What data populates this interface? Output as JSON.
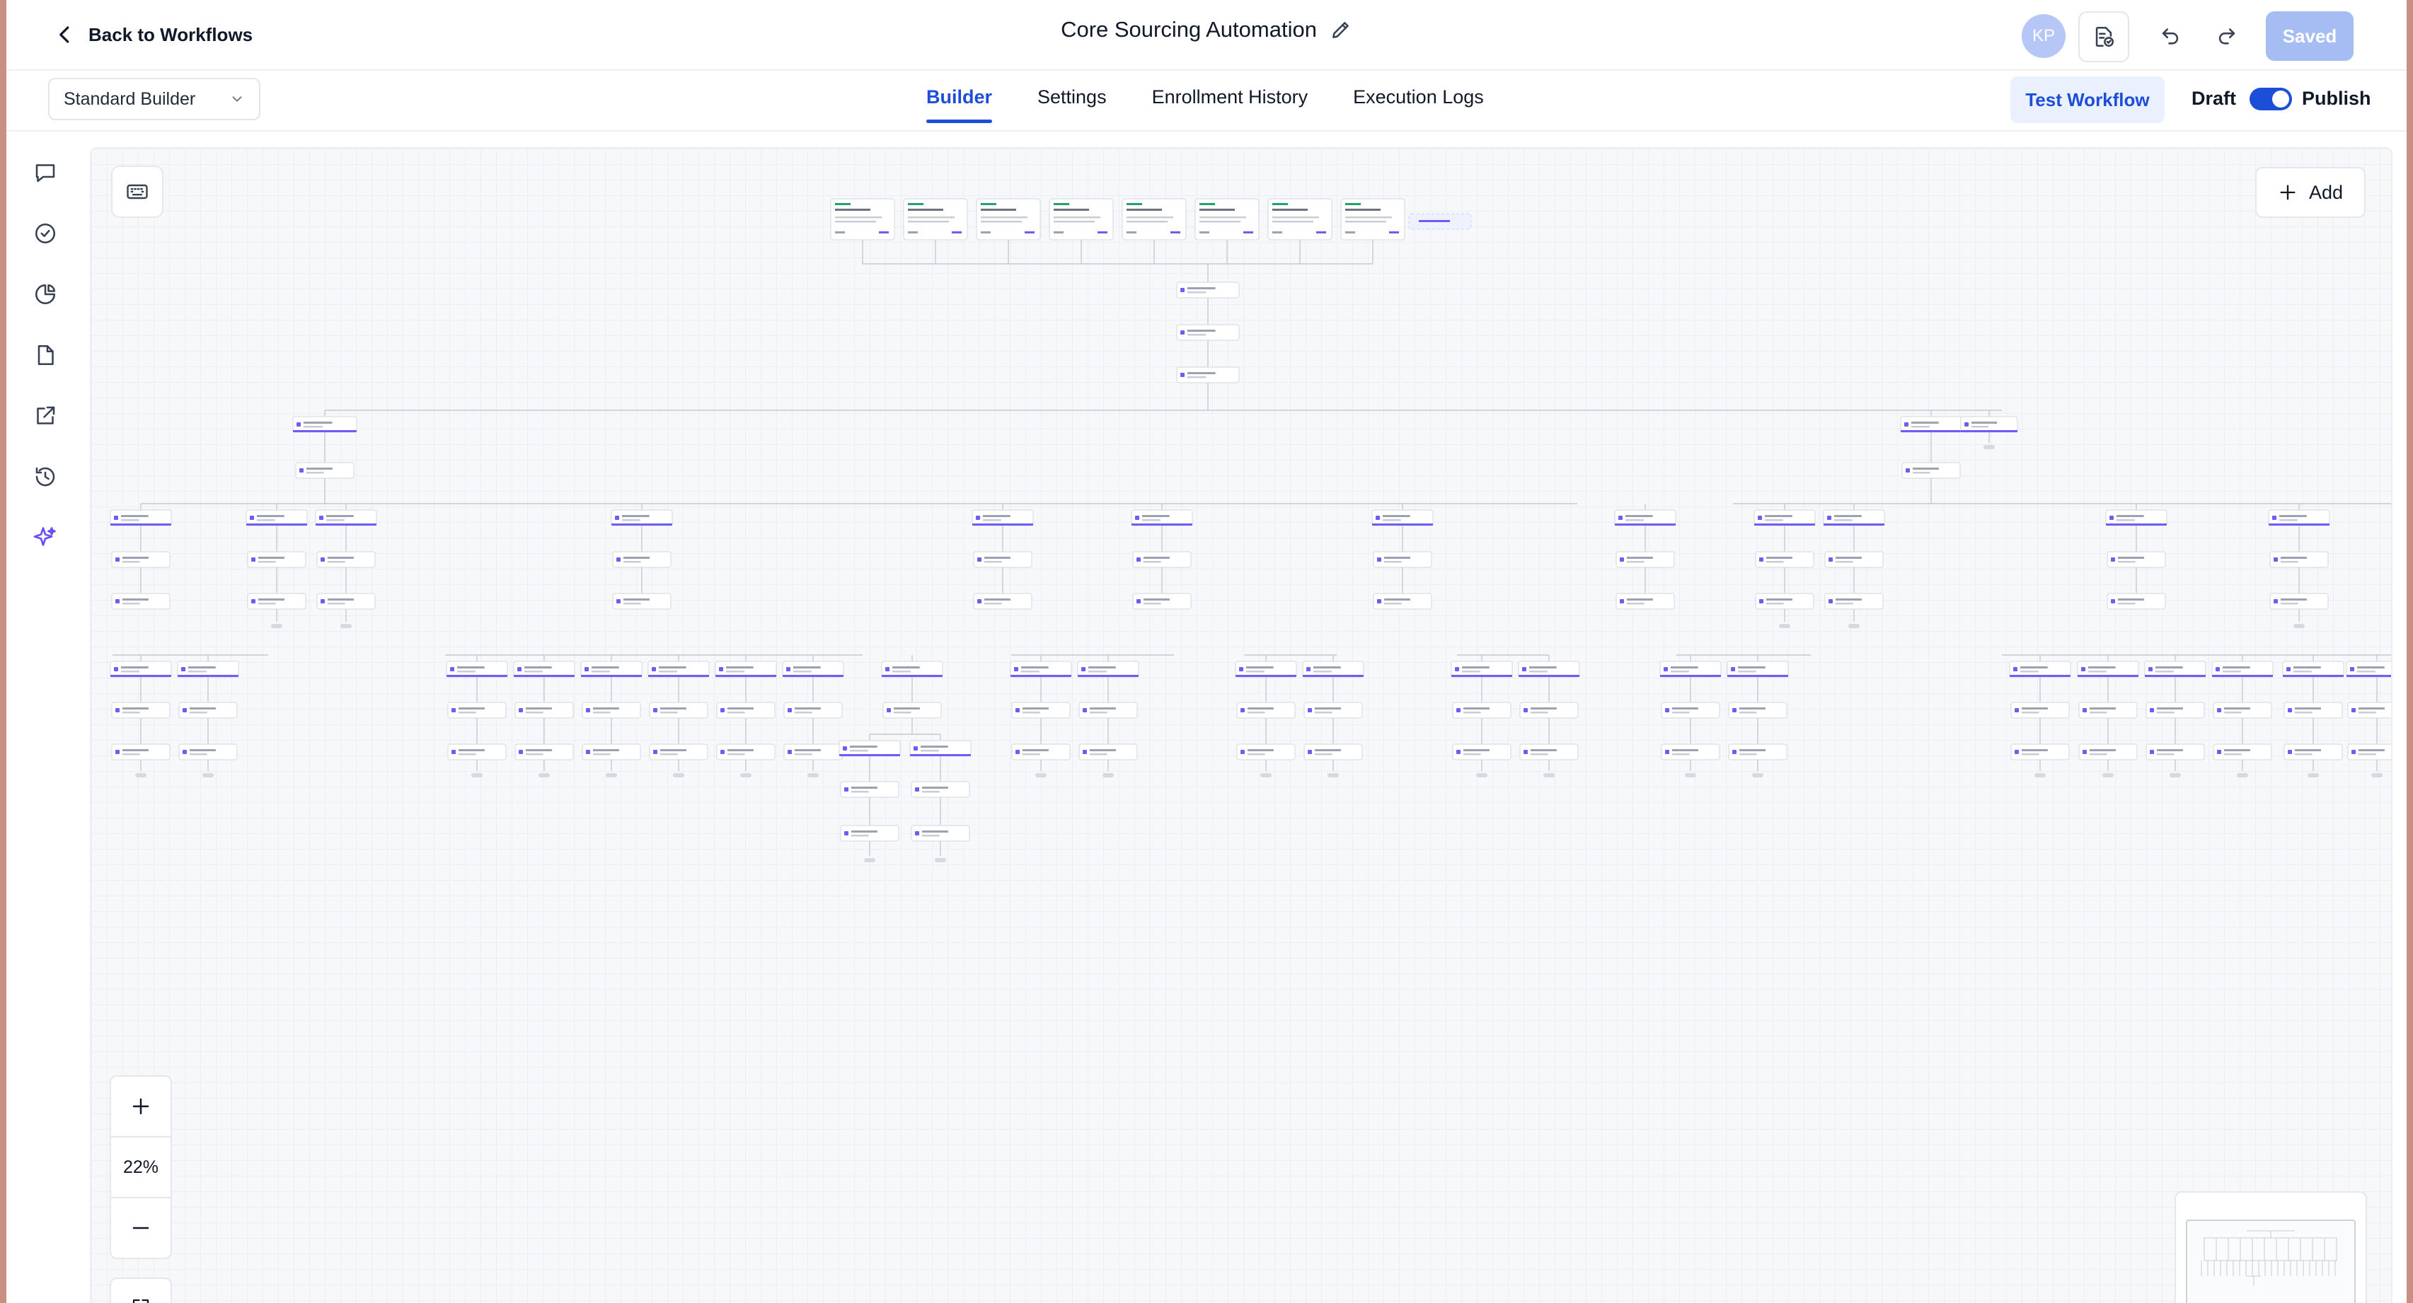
{
  "header": {
    "back_label": "Back to Workflows",
    "title": "Core Sourcing Automation",
    "avatar_initials": "KP",
    "saved_label": "Saved"
  },
  "toolbar": {
    "builder_mode": "Standard Builder",
    "tabs": [
      {
        "label": "Builder",
        "active": true
      },
      {
        "label": "Settings",
        "active": false
      },
      {
        "label": "Enrollment History",
        "active": false
      },
      {
        "label": "Execution Logs",
        "active": false
      }
    ],
    "test_label": "Test Workflow",
    "draft_label": "Draft",
    "publish_label": "Publish",
    "publish_enabled": true
  },
  "sidebar": {
    "icons": [
      "chat-icon",
      "check-circle-icon",
      "pie-chart-icon",
      "document-icon",
      "external-link-icon",
      "history-icon",
      "sparkle-icon"
    ]
  },
  "canvas": {
    "add_label": "Add",
    "zoom_level": "22%"
  },
  "colors": {
    "accent": "#1d4ed8",
    "accent_light": "#eaf0fd",
    "saved_disabled": "#a6bdf3",
    "avatar": "#b6c6f6",
    "node_accent": "#6d5df2",
    "window_frame": "#c98f80"
  }
}
